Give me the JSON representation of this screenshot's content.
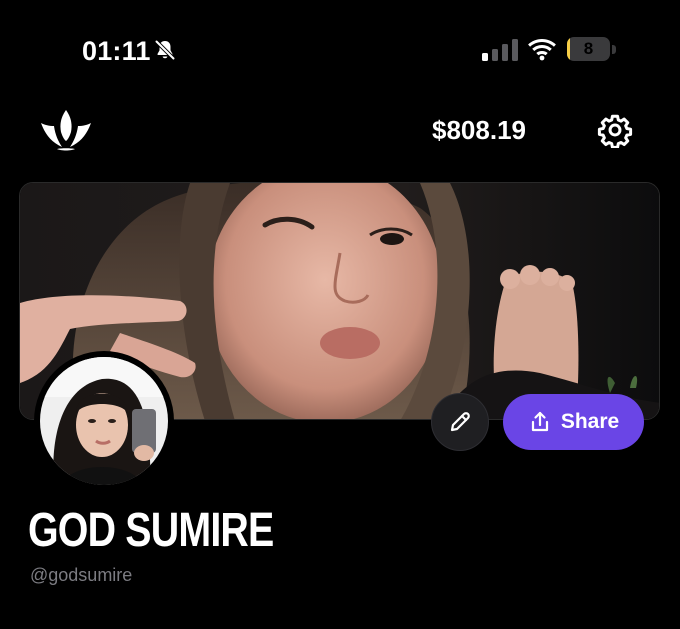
{
  "status_bar": {
    "time": "01:11",
    "battery_level": "8",
    "battery_fraction": 0.08,
    "icons": [
      "bell-muted-icon",
      "signal-icon",
      "wifi-icon",
      "battery-icon"
    ]
  },
  "header": {
    "logo_icon": "crown-logo-icon",
    "balance": "$808.19",
    "settings_icon": "gear-icon"
  },
  "profile": {
    "display_name": "GOD SUMIRE",
    "handle": "@godsumire",
    "edit_icon": "pencil-icon",
    "share_label": "Share",
    "share_icon": "share-icon"
  },
  "colors": {
    "background": "#000000",
    "accent": "#6a45e6",
    "battery": "#f7ce46",
    "muted_text": "#7c7c82"
  }
}
